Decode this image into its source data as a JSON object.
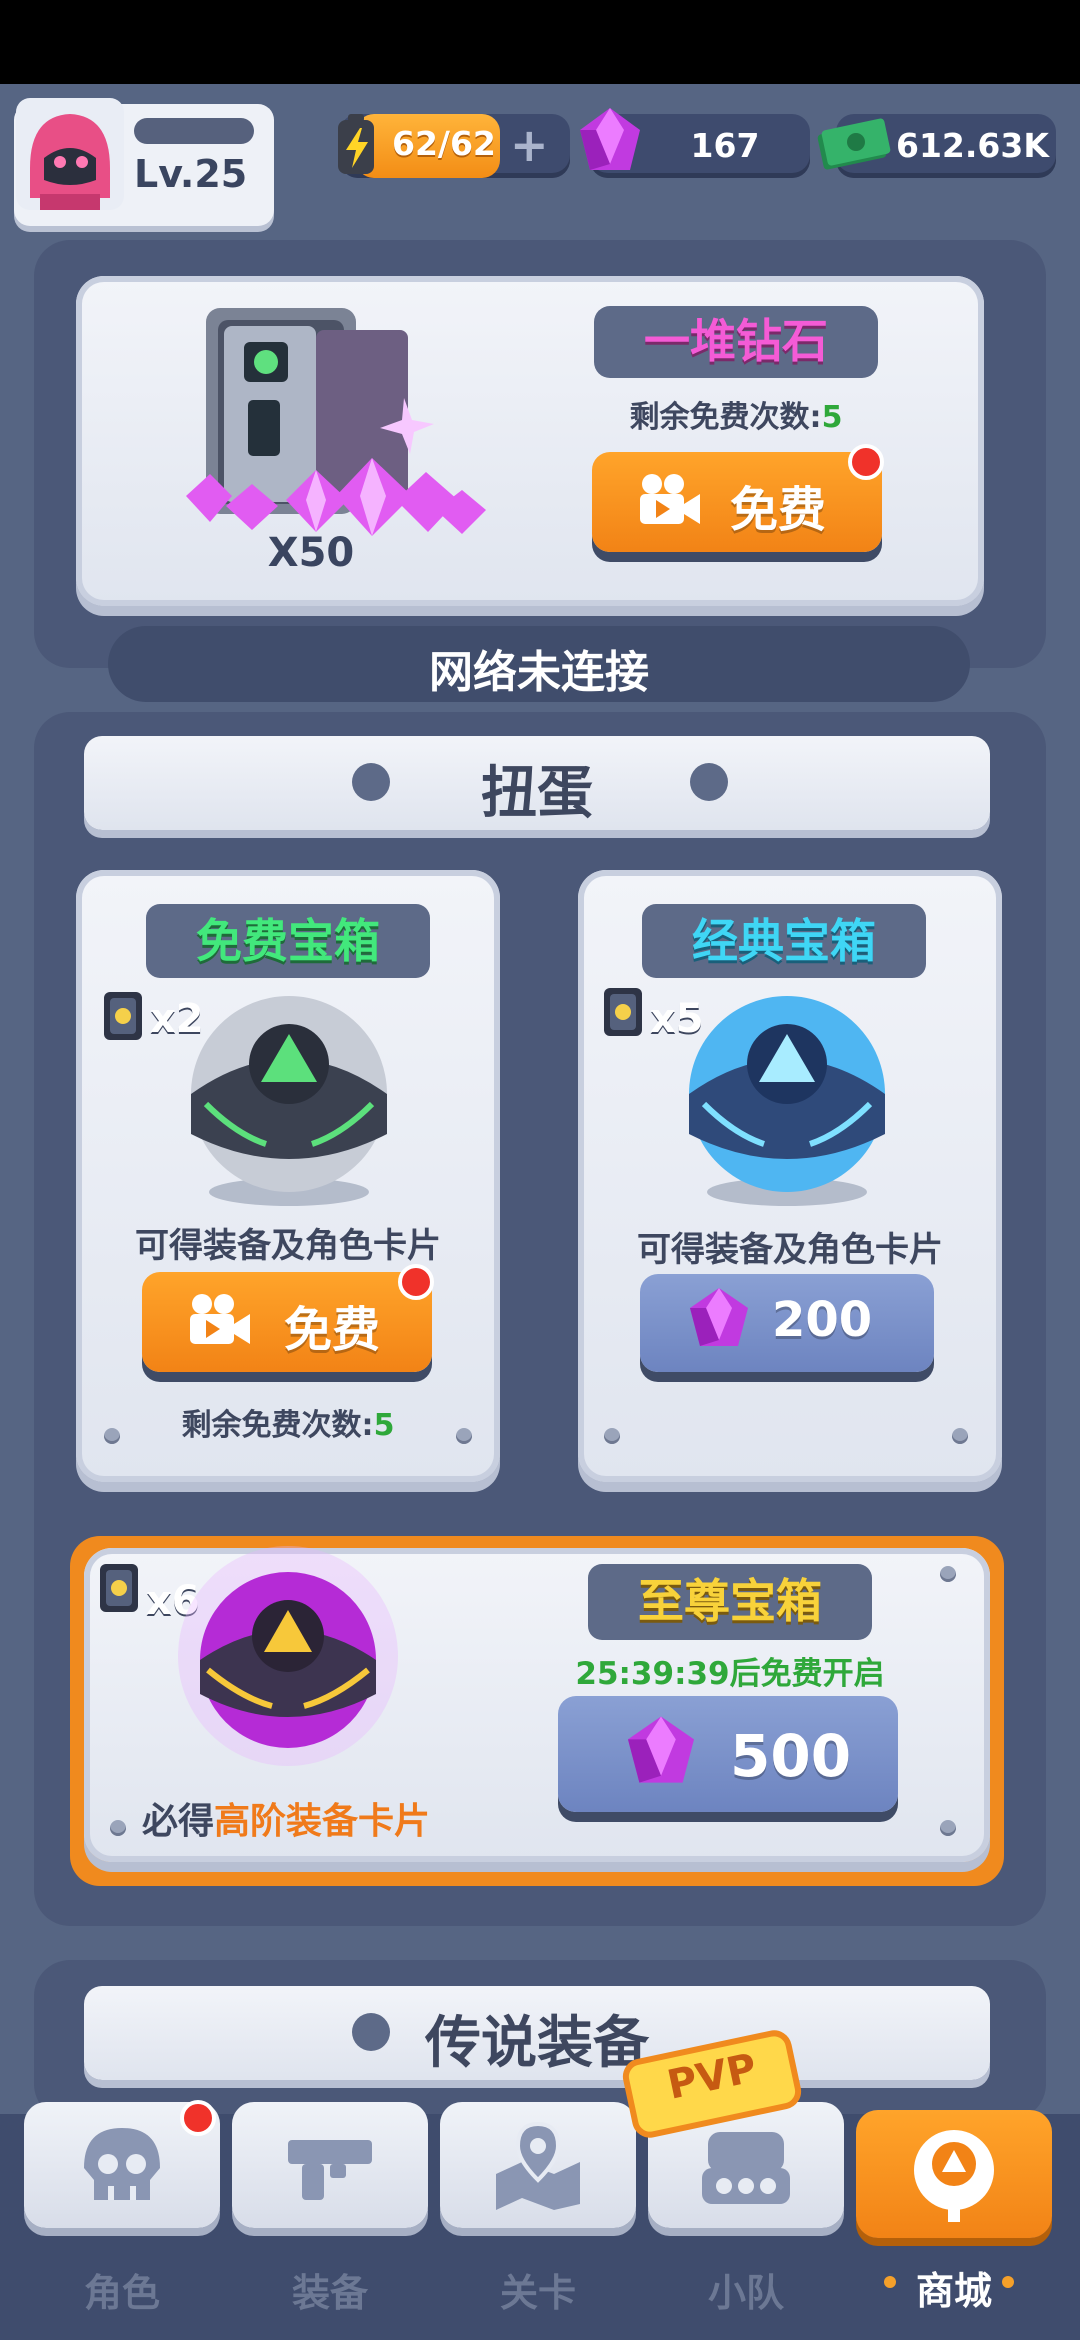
{
  "player": {
    "level": "Lv.25"
  },
  "currencies": {
    "energy": "62/62",
    "gems": "167",
    "cash": "612.63K"
  },
  "diamond_pile": {
    "title": "一堆钻石",
    "remaining_label": "剩余免费次数:",
    "remaining_count": "5",
    "free_button": "免费",
    "quantity": "X50"
  },
  "network_notice": "网络未连接",
  "gacha": {
    "header": "扭蛋",
    "free_chest": {
      "title": "免费宝箱",
      "card_count": "x2",
      "desc": "可得装备及角色卡片",
      "button": "免费",
      "remaining_label": "剩余免费次数:",
      "remaining_count": "5"
    },
    "classic_chest": {
      "title": "经典宝箱",
      "card_count": "x5",
      "desc": "可得装备及角色卡片",
      "price": "200"
    },
    "supreme_chest": {
      "title": "至尊宝箱",
      "card_count": "x6",
      "timer": "25:39:39后免费开启",
      "price": "500",
      "desc_prefix": "必得",
      "desc_highlight": "高阶装备卡片"
    }
  },
  "legend_header": "传说装备",
  "pvp_badge": "PVP",
  "tabs": [
    {
      "label": "角色",
      "icon": "skull-icon"
    },
    {
      "label": "装备",
      "icon": "gun-icon"
    },
    {
      "label": "关卡",
      "icon": "map-icon"
    },
    {
      "label": "小队",
      "icon": "squad-icon"
    },
    {
      "label": "商城",
      "icon": "shop-icon"
    }
  ],
  "colors": {
    "orange": "#f28316",
    "gem_purple": "#c13ae0",
    "cash_green": "#35b36a",
    "title_pink": "#f45bd6",
    "title_green": "#42e87c",
    "title_cyan": "#3fd6f5",
    "title_yellow": "#f8d23a",
    "count_green": "#2fa83a"
  }
}
